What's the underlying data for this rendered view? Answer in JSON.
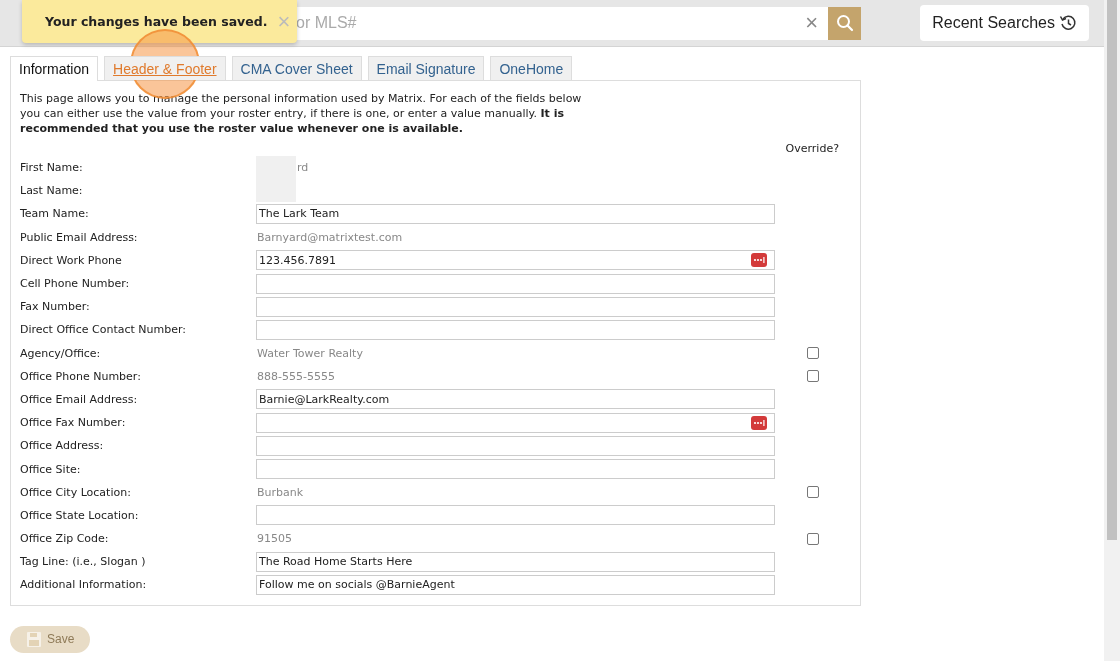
{
  "toast": {
    "message": "Your changes have been saved.",
    "close": "×"
  },
  "search": {
    "placeholder": "or MLS#",
    "clear": "×"
  },
  "recent_searches": {
    "label": "Recent Searches"
  },
  "tabs": [
    {
      "label": "Information",
      "selected": true,
      "hovered": false
    },
    {
      "label": "Header & Footer",
      "selected": false,
      "hovered": true
    },
    {
      "label": "CMA Cover Sheet",
      "selected": false,
      "hovered": false
    },
    {
      "label": "Email Signature",
      "selected": false,
      "hovered": false
    },
    {
      "label": "OneHome",
      "selected": false,
      "hovered": false
    }
  ],
  "intro": "This page allows you to manage the personal information used by Matrix. For each of the fields below you can either use the value from your roster entry, if there is one, or enter a value manually. **It is recommended that you use the roster value whenever one is available.**",
  "override_header": "Override?",
  "fields": [
    {
      "label": "First Name:",
      "kind": "text",
      "value": "rd",
      "redacted": true
    },
    {
      "label": "Last Name:",
      "kind": "text",
      "redacted": true
    },
    {
      "label": "Team Name:",
      "kind": "input",
      "value": "The Lark Team"
    },
    {
      "label": "Public Email Address:",
      "kind": "text",
      "value": "Barnyard@matrixtest.com"
    },
    {
      "label": "Direct Work Phone",
      "kind": "input",
      "value": "123.456.7891",
      "password_manager": true
    },
    {
      "label": "Cell Phone Number:",
      "kind": "input"
    },
    {
      "label": "Fax Number:",
      "kind": "input"
    },
    {
      "label": "Direct Office Contact Number:",
      "kind": "input"
    },
    {
      "label": "Agency/Office:",
      "kind": "text",
      "value": "Water Tower Realty",
      "override": {
        "checked": false
      }
    },
    {
      "label": "Office Phone Number:",
      "kind": "text",
      "value": "888-555-5555",
      "override": {
        "checked": false
      }
    },
    {
      "label": "Office Email Address:",
      "kind": "input",
      "value": "Barnie@LarkRealty.com"
    },
    {
      "label": "Office Fax Number:",
      "kind": "input",
      "password_manager": true
    },
    {
      "label": "Office Address:",
      "kind": "input"
    },
    {
      "label": "Office Site:",
      "kind": "input"
    },
    {
      "label": "Office City Location:",
      "kind": "text",
      "value": "Burbank",
      "override": {
        "checked": false
      }
    },
    {
      "label": "Office State Location:",
      "kind": "input"
    },
    {
      "label": "Office Zip Code:",
      "kind": "text",
      "value": "91505",
      "override": {
        "checked": false
      }
    },
    {
      "label": "Tag Line: (i.e., Slogan )",
      "kind": "input",
      "value": "The Road Home Starts Here"
    },
    {
      "label": "Additional Information:",
      "kind": "input",
      "value": "Follow me on socials @BarnieAgent"
    }
  ],
  "save": {
    "label": "Save",
    "disabled": true
  }
}
